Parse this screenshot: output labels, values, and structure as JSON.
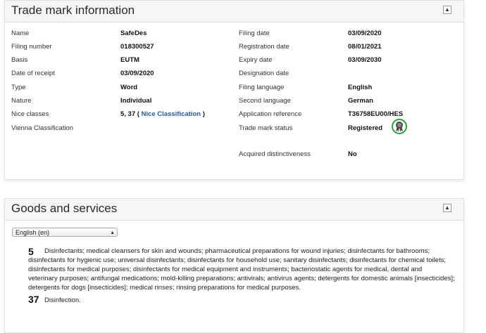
{
  "trade_mark_info": {
    "title": "Trade mark information",
    "collapse_icon": "collapse-up-arrow-icon",
    "left": [
      {
        "label": "Name",
        "value": "SafeDes"
      },
      {
        "label": "Filing number",
        "value": "018300527"
      },
      {
        "label": "Basis",
        "value": "EUTM"
      },
      {
        "label": "Date of receipt",
        "value": "03/09/2020"
      },
      {
        "label": "Type",
        "value": "Word"
      },
      {
        "label": "Nature",
        "value": "Individual"
      },
      {
        "label": "Nice classes",
        "value_prefix": "5, 37 ( ",
        "link": "Nice Classification",
        "value_suffix": " )"
      },
      {
        "label": "Vienna Classification",
        "value": ""
      }
    ],
    "right": [
      {
        "label": "Filing date",
        "value": "03/09/2020"
      },
      {
        "label": "Registration date",
        "value": "08/01/2021"
      },
      {
        "label": "Expiry date",
        "value": "03/09/2030"
      },
      {
        "label": "Designation date",
        "value": ""
      },
      {
        "label": "Filing language",
        "value": "English"
      },
      {
        "label": "Second language",
        "value": "German"
      },
      {
        "label": "Application reference",
        "value": "T36758EU00/HES"
      },
      {
        "label": "Trade mark status",
        "value": "Registered",
        "icon": "registered-seal-icon",
        "icon_border_color": "#2e9e3b"
      },
      {
        "label": "Acquired distinctiveness",
        "value": "No"
      }
    ]
  },
  "goods_services": {
    "title": "Goods and services",
    "collapse_icon": "collapse-up-arrow-icon",
    "language_select": {
      "value": "English (en)"
    },
    "classes": [
      {
        "number": "5",
        "lines": [
          "Disinfectants; medical cleansers for skin and wounds; pharmaceutical preparations for wound injuries; disinfectants for bathrooms;",
          "disinfectants for hygienic use; universal disinfectants; disinfectants for household use; sanitary disinfectants; disinfectants for chemical toilets;",
          "disinfectants for medical purposes; disinfectants for medical equipment and instruments; bacteriostatic agents for medical, dental and",
          "veterinary purposes; antifungal medications; mold-killing preparations; antivirals; antivirus agents; detergents for domestic animals [insecticides];",
          "detergents for dogs [insecticides]; medical rinses; rinsing preparations for medical purposes."
        ]
      },
      {
        "number": "37",
        "lines": [
          "Disinfection."
        ]
      }
    ]
  }
}
